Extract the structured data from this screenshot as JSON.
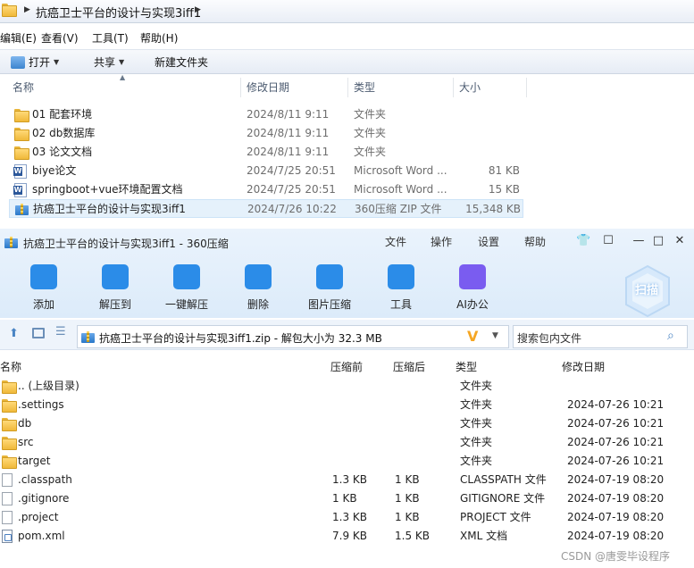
{
  "explorer": {
    "breadcrumb": "抗癌卫士平台的设计与实现3iff1",
    "menu": [
      "编辑(E)",
      "查看(V)",
      "工具(T)",
      "帮助(H)"
    ],
    "toolbar": {
      "open": "打开",
      "share": "共享",
      "new_folder": "新建文件夹"
    },
    "columns": {
      "name": "名称",
      "modified": "修改日期",
      "type": "类型",
      "size": "大小"
    },
    "files": [
      {
        "name": "01 配套环境",
        "modified": "2024/8/11 9:11",
        "type": "文件夹",
        "size": "",
        "icon": "folder-icon"
      },
      {
        "name": "02 db数据库",
        "modified": "2024/8/11 9:11",
        "type": "文件夹",
        "size": "",
        "icon": "folder-icon"
      },
      {
        "name": "03 论文文档",
        "modified": "2024/8/11 9:11",
        "type": "文件夹",
        "size": "",
        "icon": "folder-icon"
      },
      {
        "name": "biye论文",
        "modified": "2024/7/25 20:51",
        "type": "Microsoft Word ...",
        "size": "81 KB",
        "icon": "word-doc-icon"
      },
      {
        "name": "springboot+vue环境配置文档",
        "modified": "2024/7/25 20:51",
        "type": "Microsoft Word ...",
        "size": "15 KB",
        "icon": "word-doc-icon"
      },
      {
        "name": "抗癌卫士平台的设计与实现3iff1",
        "modified": "2024/7/26 10:22",
        "type": "360压缩 ZIP 文件",
        "size": "15,348 KB",
        "icon": "zip-icon"
      }
    ]
  },
  "zip": {
    "title": "抗癌卫士平台的设计与实现3iff1 - 360压缩",
    "menu": [
      "文件",
      "操作",
      "设置",
      "帮助"
    ],
    "tools": [
      {
        "label": "添加",
        "icon": "add-icon",
        "color": "#2b8ce8"
      },
      {
        "label": "解压到",
        "icon": "extract-to-icon",
        "color": "#2b8ce8"
      },
      {
        "label": "一键解压",
        "icon": "one-click-extract-icon",
        "color": "#2b8ce8"
      },
      {
        "label": "删除",
        "icon": "delete-icon",
        "color": "#2b8ce8"
      },
      {
        "label": "图片压缩",
        "icon": "image-compress-icon",
        "color": "#2b8ce8"
      },
      {
        "label": "工具",
        "icon": "tools-icon",
        "color": "#2b8ce8"
      },
      {
        "label": "AI办公",
        "icon": "ai-office-icon",
        "color": "#7a5cf0"
      }
    ],
    "scan_label": "扫描",
    "path": "抗癌卫士平台的设计与实现3iff1.zip - 解包大小为 32.3 MB",
    "search_placeholder": "搜索包内文件",
    "columns": {
      "name": "名称",
      "compressed_before": "压缩前",
      "compressed_after": "压缩后",
      "type": "类型",
      "modified": "修改日期"
    },
    "entries": [
      {
        "name": ".. (上级目录)",
        "before": "",
        "after": "",
        "type": "文件夹",
        "modified": "",
        "icon": "folder-icon"
      },
      {
        "name": ".settings",
        "before": "",
        "after": "",
        "type": "文件夹",
        "modified": "2024-07-26 10:21",
        "icon": "folder-icon"
      },
      {
        "name": "db",
        "before": "",
        "after": "",
        "type": "文件夹",
        "modified": "2024-07-26 10:21",
        "icon": "folder-icon"
      },
      {
        "name": "src",
        "before": "",
        "after": "",
        "type": "文件夹",
        "modified": "2024-07-26 10:21",
        "icon": "folder-icon"
      },
      {
        "name": "target",
        "before": "",
        "after": "",
        "type": "文件夹",
        "modified": "2024-07-26 10:21",
        "icon": "folder-icon"
      },
      {
        "name": ".classpath",
        "before": "1.3 KB",
        "after": "1 KB",
        "type": "CLASSPATH 文件",
        "modified": "2024-07-19 08:20",
        "icon": "file-icon"
      },
      {
        "name": ".gitignore",
        "before": "1 KB",
        "after": "1 KB",
        "type": "GITIGNORE 文件",
        "modified": "2024-07-19 08:20",
        "icon": "file-icon"
      },
      {
        "name": ".project",
        "before": "1.3 KB",
        "after": "1 KB",
        "type": "PROJECT 文件",
        "modified": "2024-07-19 08:20",
        "icon": "file-icon"
      },
      {
        "name": "pom.xml",
        "before": "7.9 KB",
        "after": "1.5 KB",
        "type": "XML 文档",
        "modified": "2024-07-19 08:20",
        "icon": "xml-file-icon"
      }
    ],
    "watermark": "CSDN @唐雯毕设程序"
  }
}
